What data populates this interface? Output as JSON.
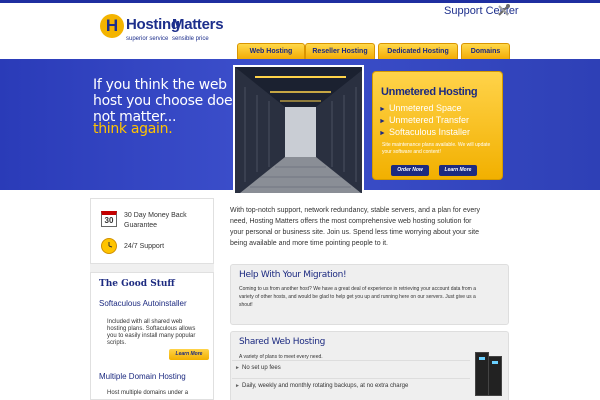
{
  "header": {
    "logo_icon": "H",
    "logo_word1": "Hosting",
    "logo_word2": "Matters",
    "logo_tag1": "superior service",
    "logo_tag2": "sensible price",
    "support_label": "Support Center"
  },
  "nav": {
    "tabs": [
      {
        "label": "Web Hosting"
      },
      {
        "label": "Reseller Hosting"
      },
      {
        "label": "Dedicated Hosting"
      },
      {
        "label": "Domains"
      }
    ]
  },
  "hero": {
    "lines": [
      "If you think the web",
      "host you choose does",
      "not matter..."
    ],
    "highlight": "think again."
  },
  "offer": {
    "title": "Unmetered Hosting",
    "items": [
      "Unmetered Space",
      "Unmetered Transfer",
      "Softaculous Installer"
    ],
    "note": "Site maintenance plans available. We will update your software and content!",
    "order_label": "Order Now",
    "learn_label": "Learn More"
  },
  "badges": {
    "calendar_number": "30",
    "money_back_line1": "30 Day Money Back",
    "money_back_line2": "Guarantee",
    "support": "24/7 Support"
  },
  "good_stuff": {
    "title": "The Good Stuff",
    "item1_title": "Softaculous Autoinstaller",
    "item1_lines": [
      "Included with all shared web",
      "hosting plans. Softaculous allows",
      "you to easily install many popular",
      "scripts."
    ],
    "learn_label": "Learn More",
    "item2_title": "Multiple Domain Hosting",
    "item2_line": "Host multiple domains under a"
  },
  "intro": {
    "lines": [
      "With top-notch support, network redundancy, stable servers, and a plan for every",
      "need, Hosting Matters offers the most comprehensive web hosting solution for",
      "your personal or business site. Join us. Spend less time worrying about your site",
      "being available and more time pointing people to it."
    ]
  },
  "migration": {
    "title": "Help With Your Migration!",
    "lines": [
      "Coming to us from another host? We have a great deal of experience in retrieving your account data from a",
      "variety of other hosts, and would be glad to help get you up and running here on our servers. Just give us a",
      "shout!"
    ]
  },
  "shared": {
    "title": "Shared Web Hosting",
    "subtitle": "A variety of plans to meet every need.",
    "features": [
      "No set up fees",
      "Daily, weekly and monthly rotating backups, at no extra charge"
    ]
  },
  "colors": {
    "brand_blue": "#1c2a80",
    "hero_blue": "#3344c0",
    "gold": "#f4b400"
  }
}
